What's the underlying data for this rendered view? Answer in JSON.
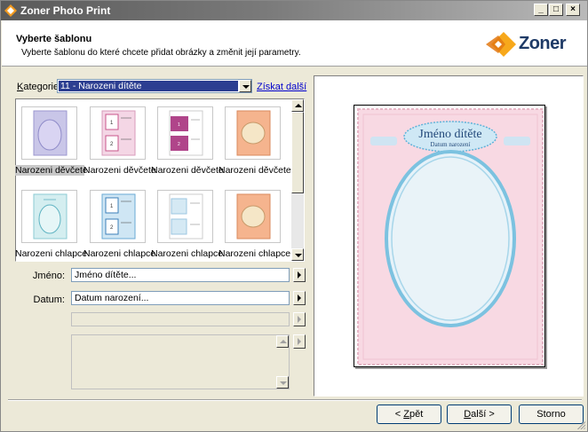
{
  "window": {
    "title": "Zoner Photo Print"
  },
  "header": {
    "heading": "Vyberte šablonu",
    "subheading": "Vyberte šablonu do které chcete přidat obrázky a změnit její parametry.",
    "logo_text": "Zoner"
  },
  "category": {
    "label_first": "K",
    "label_rest": "ategorie:",
    "selected": "11 - Narozeni dítěte",
    "link": "Získat další"
  },
  "templates": [
    {
      "label": "Narozeni děvčete",
      "style": "girl-oval",
      "selected": true
    },
    {
      "label": "Narozeni děvčete",
      "style": "girl-two",
      "selected": false
    },
    {
      "label": "Narozeni děvčete",
      "style": "girl-purple",
      "selected": false
    },
    {
      "label": "Narozeni děvčete",
      "style": "peach-oval",
      "selected": false
    },
    {
      "label": "Narozeni chlapce",
      "style": "boy-oval",
      "selected": false
    },
    {
      "label": "Narozeni chlapce",
      "style": "boy-two",
      "selected": false
    },
    {
      "label": "Narozeni chlapce",
      "style": "boy-light",
      "selected": false
    },
    {
      "label": "Narozeni chlapce",
      "style": "peach-oval",
      "selected": false
    }
  ],
  "fields": {
    "name_label": "Jméno:",
    "name_value": "Jméno dítěte...",
    "date_label": "Datum:",
    "date_value": "Datum narození..."
  },
  "preview": {
    "name_text": "Jméno dítěte",
    "date_text": "Datum narození"
  },
  "buttons": {
    "back_prefix": "< ",
    "back_key": "Z",
    "back_rest": "pět",
    "next_key": "D",
    "next_rest": "alší >",
    "cancel": "Storno"
  },
  "colors": {
    "girl_pink": "#f6d9e2",
    "boy_blue": "#cfe8f2",
    "selection": "#2c3e91"
  }
}
